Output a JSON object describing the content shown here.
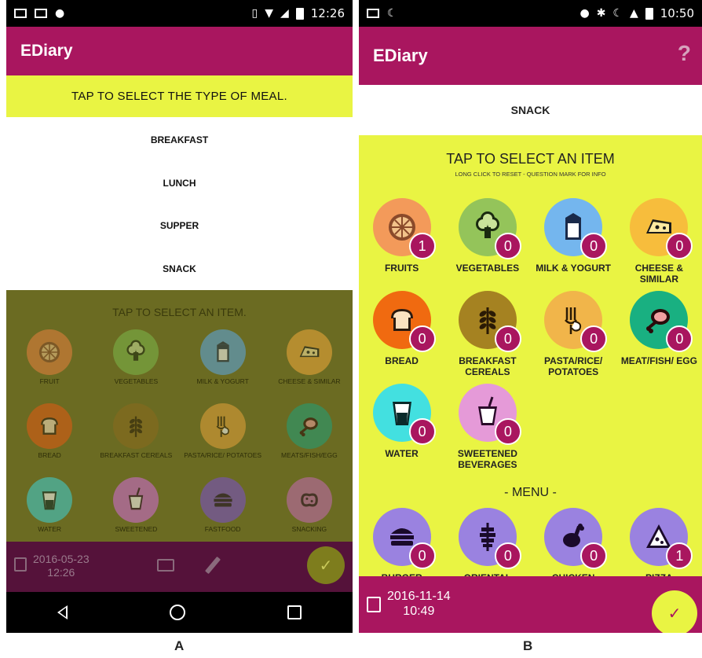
{
  "screen_a": {
    "status_time": "12:26",
    "app_title": "EDiary",
    "meal_prompt": "TAP TO SELECT THE TYPE OF MEAL.",
    "meals": [
      "BREAKFAST",
      "LUNCH",
      "SUPPER",
      "SNACK"
    ],
    "dimmed_title": "TAP TO SELECT AN ITEM.",
    "items": [
      {
        "label": "FRUIT",
        "icon": "fruit-icon",
        "color": "#e8803f"
      },
      {
        "label": "VEGETABLES",
        "icon": "vegetables-icon",
        "color": "#7db84a"
      },
      {
        "label": "MILK & YOGURT",
        "icon": "milk-icon",
        "color": "#5ba8e5"
      },
      {
        "label": "CHEESE & SIMILAR",
        "icon": "cheese-icon",
        "color": "#f2a93b"
      },
      {
        "label": "BREAD",
        "icon": "bread-icon",
        "color": "#e35a12"
      },
      {
        "label": "BREAKFAST CEREALS",
        "icon": "cereals-icon",
        "color": "#8a6a1e"
      },
      {
        "label": "PASTA/RICE/ POTATOES",
        "icon": "pasta-icon",
        "color": "#e5a33a"
      },
      {
        "label": "MEATS/FISH/EGG",
        "icon": "meat-icon",
        "color": "#1fa07a"
      },
      {
        "label": "WATER",
        "icon": "water-icon",
        "color": "#3fd1d4"
      },
      {
        "label": "SWEETENED",
        "icon": "sweetened-icon",
        "color": "#d46bd8"
      },
      {
        "label": "FASTFOOD",
        "icon": "fastfood-icon",
        "color": "#7a4fd0"
      },
      {
        "label": "SNACKING",
        "icon": "snacking-icon",
        "color": "#c46ab5"
      }
    ],
    "date": "2016-05-23",
    "time": "12:26",
    "done_symbol": "✓"
  },
  "screen_b": {
    "status_time": "10:50",
    "app_title": "EDiary",
    "help_symbol": "?",
    "selected_meal": "SNACK",
    "title": "TAP TO SELECT AN ITEM",
    "subtitle": "LONG CLICK TO RESET - QUESTION MARK FOR INFO",
    "items": [
      {
        "label": "FRUITS",
        "count": "1",
        "icon": "fruit-icon",
        "color": "#f39a5a"
      },
      {
        "label": "VEGETABLES",
        "count": "0",
        "icon": "vegetables-icon",
        "color": "#94c45a"
      },
      {
        "label": "MILK & YOGURT",
        "count": "0",
        "icon": "milk-icon",
        "color": "#74b6ee"
      },
      {
        "label": "CHEESE & SIMILAR",
        "count": "0",
        "icon": "cheese-icon",
        "color": "#f7bd3c"
      },
      {
        "label": "BREAD",
        "count": "0",
        "icon": "bread-icon",
        "color": "#f06a10"
      },
      {
        "label": "BREAKFAST CEREALS",
        "count": "0",
        "icon": "cereals-icon",
        "color": "#a58221"
      },
      {
        "label": "PASTA/RICE/ POTATOES",
        "count": "0",
        "icon": "pasta-icon",
        "color": "#f1b54a"
      },
      {
        "label": "MEAT/FISH/ EGG",
        "count": "0",
        "icon": "meat-icon",
        "color": "#19b081"
      },
      {
        "label": "WATER",
        "count": "0",
        "icon": "water-icon",
        "color": "#43e0e0"
      },
      {
        "label": "SWEETENED BEVERAGES",
        "count": "0",
        "icon": "sweetened-icon",
        "color": "#e59ad8"
      }
    ],
    "menu_header": "- MENU -",
    "menu_items": [
      {
        "label": "BURGER",
        "count": "0",
        "icon": "burger-icon",
        "color": "#9a82e0"
      },
      {
        "label": "ORIENTAL",
        "count": "0",
        "icon": "kebab-icon",
        "color": "#9a82e0"
      },
      {
        "label": "CHICKEN",
        "count": "0",
        "icon": "chicken-icon",
        "color": "#9a82e0"
      },
      {
        "label": "PIZZA",
        "count": "1",
        "icon": "pizza-icon",
        "color": "#9a82e0"
      }
    ],
    "date": "2016-11-14",
    "time": "10:49",
    "done_symbol": "✓"
  },
  "panel_labels": [
    "A",
    "B"
  ]
}
